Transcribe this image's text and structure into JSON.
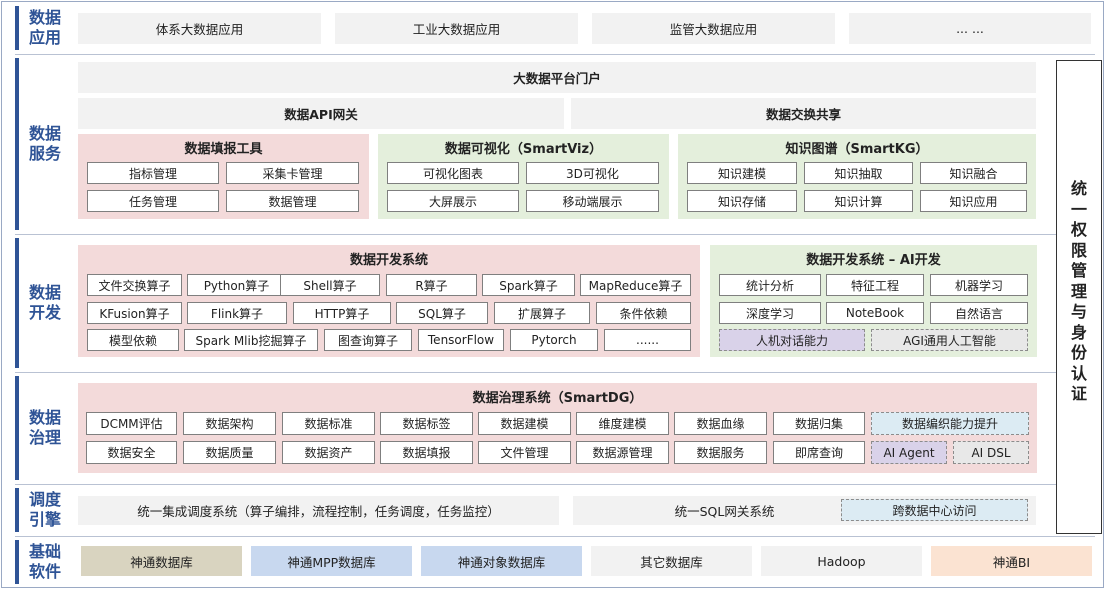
{
  "layers": {
    "app": "数据应用",
    "service": "数据服务",
    "dev": "数据开发",
    "gov": "数据治理",
    "sched": "调度引擎",
    "base": "基础软件"
  },
  "app": {
    "items": [
      "体系大数据应用",
      "工业大数据应用",
      "监管大数据应用",
      "... ..."
    ]
  },
  "service": {
    "portal": "大数据平台门户",
    "api_gateway": "数据API网关",
    "exchange": "数据交换共享",
    "fill_tool": {
      "title": "数据填报工具",
      "items": [
        "指标管理",
        "采集卡管理",
        "任务管理",
        "数据管理"
      ]
    },
    "smartviz": {
      "title": "数据可视化（SmartViz）",
      "items": [
        "可视化图表",
        "3D可视化",
        "大屏展示",
        "移动端展示"
      ]
    },
    "smartkg": {
      "title": "知识图谱（SmartKG）",
      "items": [
        "知识建模",
        "知识抽取",
        "知识融合",
        "知识存储",
        "知识计算",
        "知识应用"
      ]
    }
  },
  "dev": {
    "system": {
      "title": "数据开发系统",
      "row1": [
        "文件交换算子",
        "Python算子",
        "Shell算子",
        "R算子",
        "Spark算子",
        "MapReduce算子"
      ],
      "row2": [
        "KFusion算子",
        "Flink算子",
        "HTTP算子",
        "SQL算子",
        "扩展算子",
        "条件依赖"
      ],
      "row3": [
        "模型依赖",
        "Spark Mlib挖掘算子",
        "图查询算子",
        "TensorFlow",
        "Pytorch",
        "......"
      ]
    },
    "ai": {
      "title": "数据开发系统 – AI开发",
      "row1": [
        "统计分析",
        "特征工程",
        "机器学习"
      ],
      "row2": [
        "深度学习",
        "NoteBook",
        "自然语言"
      ],
      "row3": [
        "人机对话能力",
        "AGI通用人工智能"
      ]
    }
  },
  "gov": {
    "title": "数据治理系统（SmartDG）",
    "row1": [
      "DCMM评估",
      "数据架构",
      "数据标准",
      "数据标签",
      "数据建模",
      "维度建模",
      "数据血缘",
      "数据归集",
      "数据编织能力提升"
    ],
    "row2": [
      "数据安全",
      "数据质量",
      "数据资产",
      "数据填报",
      "文件管理",
      "数据源管理",
      "数据服务",
      "即席查询",
      "AI Agent",
      "AI DSL"
    ]
  },
  "sched": {
    "unified": "统一集成调度系统（算子编排，流程控制，任务调度，任务监控）",
    "sql_gateway": "统一SQL网关系统",
    "cross_dc": "跨数据中心访问"
  },
  "base": {
    "items": [
      "神通数据库",
      "神通MPP数据库",
      "神通对象数据库",
      "其它数据库",
      "Hadoop",
      "神通BI"
    ],
    "colors": [
      "#d9d4c0",
      "#c8d8ef",
      "#c8d8ef",
      "#f2f2f2",
      "#f2f2f2",
      "#fbe3d2"
    ]
  },
  "auth": "统一权限管理与身份认证"
}
